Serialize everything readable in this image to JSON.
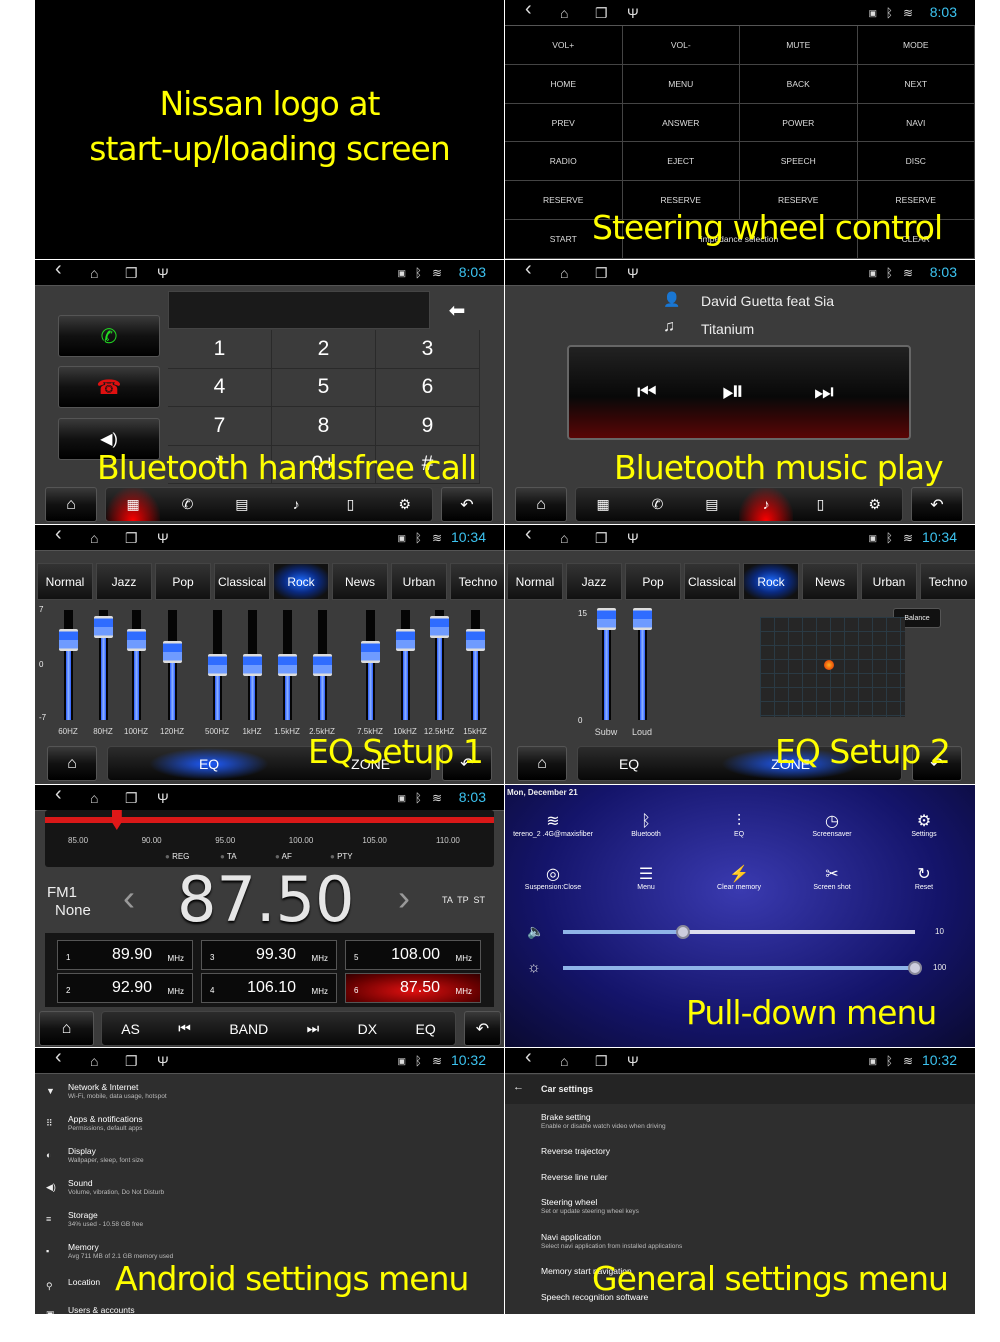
{
  "colors": {
    "caption": "#ffff00",
    "clock": "#3cc3f0",
    "accent_blue": "#1d6bff",
    "accent_red": "#e01010",
    "call_green": "#22dd22"
  },
  "status_icons": [
    "back-icon",
    "home-icon",
    "recent-apps-icon",
    "usb-icon",
    "image-icon",
    "bluetooth-icon",
    "wifi-icon"
  ],
  "startup": {
    "caption_lines": [
      "Nissan logo at",
      "start-up/loading screen"
    ]
  },
  "steering": {
    "time": "8:03",
    "caption": "Steering wheel control",
    "buttons": [
      "VOL+",
      "VOL-",
      "MUTE",
      "MODE",
      "HOME",
      "MENU",
      "BACK",
      "NEXT",
      "PREV",
      "ANSWER",
      "POWER",
      "NAVI",
      "RADIO",
      "EJECT",
      "SPEECH",
      "DISC",
      "RESERVE",
      "RESERVE",
      "RESERVE",
      "RESERVE"
    ],
    "last_row": {
      "start": "START",
      "impedance": "impedance selection",
      "clear": "CLEAR"
    }
  },
  "bt_call": {
    "time": "8:03",
    "caption": "Bluetooth handsfree call",
    "keys": [
      "1",
      "2",
      "3",
      "4",
      "5",
      "6",
      "7",
      "8",
      "9",
      "*",
      "0+",
      "#"
    ],
    "dock": [
      "dialpad-icon",
      "call-log-icon",
      "contacts-icon",
      "bt-music-icon",
      "phone-link-icon",
      "settings-icon"
    ],
    "active_tab": 0
  },
  "bt_music": {
    "time": "8:03",
    "caption": "Bluetooth music play",
    "artist": "David Guetta feat Sia",
    "title": "Titanium",
    "active_tab": 3
  },
  "eq1": {
    "time": "10:34",
    "caption": "EQ Setup 1",
    "presets": [
      "Normal",
      "Jazz",
      "Pop",
      "Classical",
      "Rock",
      "News",
      "Urban",
      "Techno"
    ],
    "active_preset": "Rock",
    "tabs": {
      "eq": "EQ",
      "zone": "ZONE"
    },
    "chart_data": {
      "type": "bar",
      "ylim": [
        -7,
        7
      ],
      "ytick_labels": [
        "7",
        "0",
        "-7"
      ],
      "categories": [
        "60HZ",
        "80HZ",
        "100HZ",
        "120HZ",
        "500HZ",
        "1kHZ",
        "1.5kHZ",
        "2.5kHZ",
        "7.5kHZ",
        "10kHZ",
        "12.5kHZ",
        "15kHZ"
      ],
      "values": [
        4,
        6,
        4,
        2,
        0,
        0,
        0,
        0,
        2,
        4,
        6,
        4
      ]
    }
  },
  "eq2": {
    "time": "10:34",
    "caption": "EQ Setup 2",
    "balance": "Balance",
    "tabs": {
      "eq": "EQ",
      "zone": "ZONE"
    },
    "chart_data": {
      "type": "bar",
      "ylim": [
        0,
        15
      ],
      "ytick_labels": [
        "15",
        "0"
      ],
      "categories": [
        "Subw",
        "Loud"
      ],
      "values": [
        15,
        15
      ]
    }
  },
  "radio": {
    "time": "8:03",
    "band": "FM1",
    "ps": "None",
    "frequency": "87.50",
    "flags": "TA  TP  ST",
    "scale": [
      "85.00",
      "90.00",
      "95.00",
      "100.00",
      "105.00",
      "110.00"
    ],
    "needle_mhz": 87.5,
    "options": [
      "REG",
      "TA",
      "AF",
      "PTY"
    ],
    "presets": [
      {
        "n": "1",
        "f": "89.90"
      },
      {
        "n": "2",
        "f": "92.90"
      },
      {
        "n": "3",
        "f": "99.30"
      },
      {
        "n": "4",
        "f": "106.10"
      },
      {
        "n": "5",
        "f": "108.00"
      },
      {
        "n": "6",
        "f": "87.50"
      }
    ],
    "unit": "MHz",
    "active_preset": "6",
    "bottom": [
      "AS",
      "BAND",
      "DX",
      "EQ"
    ]
  },
  "pulldown": {
    "date": "Mon, December 21",
    "caption": "Pull-down menu",
    "tiles": [
      {
        "icon": "wifi-icon",
        "label": "tereno_2 .4G@maxisfiber"
      },
      {
        "icon": "bluetooth-icon",
        "label": "Bluetooth"
      },
      {
        "icon": "equalizer-icon",
        "label": "EQ"
      },
      {
        "icon": "timer-icon",
        "label": "Screensaver"
      },
      {
        "icon": "gear-icon",
        "label": "Settings"
      },
      {
        "icon": "target-icon",
        "label": "Suspension:Close"
      },
      {
        "icon": "list-icon",
        "label": "Menu"
      },
      {
        "icon": "lightning-icon",
        "label": "Clear memory"
      },
      {
        "icon": "scissors-icon",
        "label": "Screen shot"
      },
      {
        "icon": "reset-icon",
        "label": "Reset"
      }
    ],
    "volume": {
      "value": "10",
      "level": 0.34
    },
    "brightness": {
      "value": "100",
      "level": 1.0
    }
  },
  "android_settings": {
    "time": "10:32",
    "caption": "Android settings menu",
    "items": [
      {
        "icon": "wifi-icon",
        "t": "Network & Internet",
        "s": "Wi-Fi, mobile, data usage, hotspot"
      },
      {
        "icon": "apps-icon",
        "t": "Apps & notifications",
        "s": "Permissions, default apps"
      },
      {
        "icon": "brightness-icon",
        "t": "Display",
        "s": "Wallpaper, sleep, font size"
      },
      {
        "icon": "speaker-icon",
        "t": "Sound",
        "s": "Volume, vibration, Do Not Disturb"
      },
      {
        "icon": "storage-icon",
        "t": "Storage",
        "s": "34% used - 10.58 GB free"
      },
      {
        "icon": "memory-icon",
        "t": "Memory",
        "s": "Avg 711 MB of 2.1 GB memory used"
      },
      {
        "icon": "location-icon",
        "t": "Location",
        "s": ""
      },
      {
        "icon": "account-icon",
        "t": "Users & accounts",
        "s": ""
      }
    ]
  },
  "general_settings": {
    "time": "10:32",
    "caption": "General settings menu",
    "header": "Car settings",
    "items": [
      {
        "t": "Brake setting",
        "s": "Enable or disable watch video when driving"
      },
      {
        "t": "Reverse trajectory",
        "s": ""
      },
      {
        "t": "Reverse line ruler",
        "s": ""
      },
      {
        "t": "Steering wheel",
        "s": "Set or update steering wheel keys"
      },
      {
        "t": "Navi application",
        "s": "Select navi application from installed applications"
      },
      {
        "t": "Memory start navigation",
        "s": ""
      },
      {
        "t": "Speech recognition software",
        "s": ""
      }
    ]
  }
}
